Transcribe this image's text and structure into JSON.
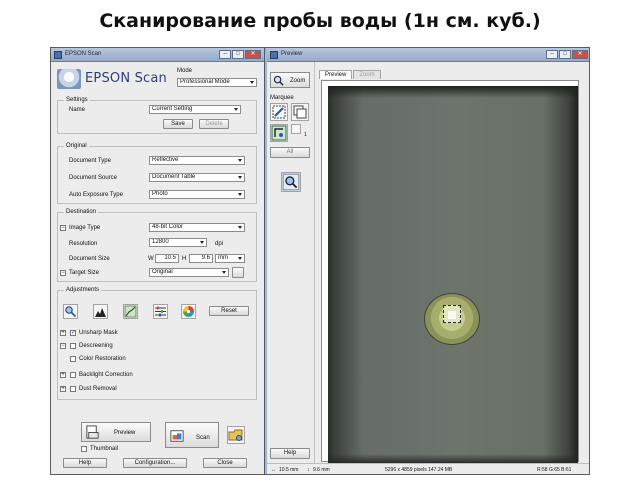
{
  "slide": {
    "title": "Сканирование пробы воды (1н см. куб.)"
  },
  "scan_window": {
    "title": "EPSON Scan",
    "brand": "EPSON Scan",
    "mode_label": "Mode",
    "mode_value": "Professional Mode",
    "settings": {
      "group_title": "Settings",
      "name_label": "Name",
      "name_value": "Current Setting",
      "save_label": "Save",
      "delete_label": "Delete"
    },
    "original": {
      "group_title": "Original",
      "document_type_label": "Document Type",
      "document_type_value": "Reflective",
      "document_source_label": "Document Source",
      "document_source_value": "Document Table",
      "auto_exposure_label": "Auto Exposure Type",
      "auto_exposure_value": "Photo"
    },
    "destination": {
      "group_title": "Destination",
      "image_type_label": "Image Type",
      "image_type_value": "48-bit Color",
      "resolution_label": "Resolution",
      "resolution_value": "12800",
      "resolution_unit": "dpi",
      "document_size_label": "Document Size",
      "width_prefix": "W",
      "width_value": "10.5",
      "height_prefix": "H",
      "height_value": "9.6",
      "size_unit": "mm",
      "target_size_label": "Target Size",
      "target_size_value": "Original"
    },
    "adjustments": {
      "group_title": "Adjustments",
      "reset_label": "Reset",
      "unsharp_mask": "Unsharp Mask",
      "unsharp_checked": true,
      "descreening": "Descreening",
      "color_restoration": "Color Restoration",
      "backlight_correction": "Backlight Correction",
      "dust_removal": "Dust Removal"
    },
    "preview_button": "Preview",
    "scan_button": "Scan",
    "thumbnail_label": "Thumbnail",
    "help_button": "Help",
    "configuration_button": "Configuration...",
    "close_button": "Close"
  },
  "preview_window": {
    "title": "Preview",
    "zoom_button": "Zoom",
    "marquee_label": "Marquee",
    "marquee_count": "1",
    "all_button": "All",
    "help_button": "Help",
    "tabs": [
      {
        "label": "Preview",
        "active": true
      },
      {
        "label": "Zoom",
        "active": false
      }
    ],
    "status": {
      "width": "10.5 mm",
      "height": "9.6 mm",
      "pixels": "5296 x 4859 pixels 147.24 MB",
      "rgb": "R:58 G:65 B:61"
    }
  }
}
